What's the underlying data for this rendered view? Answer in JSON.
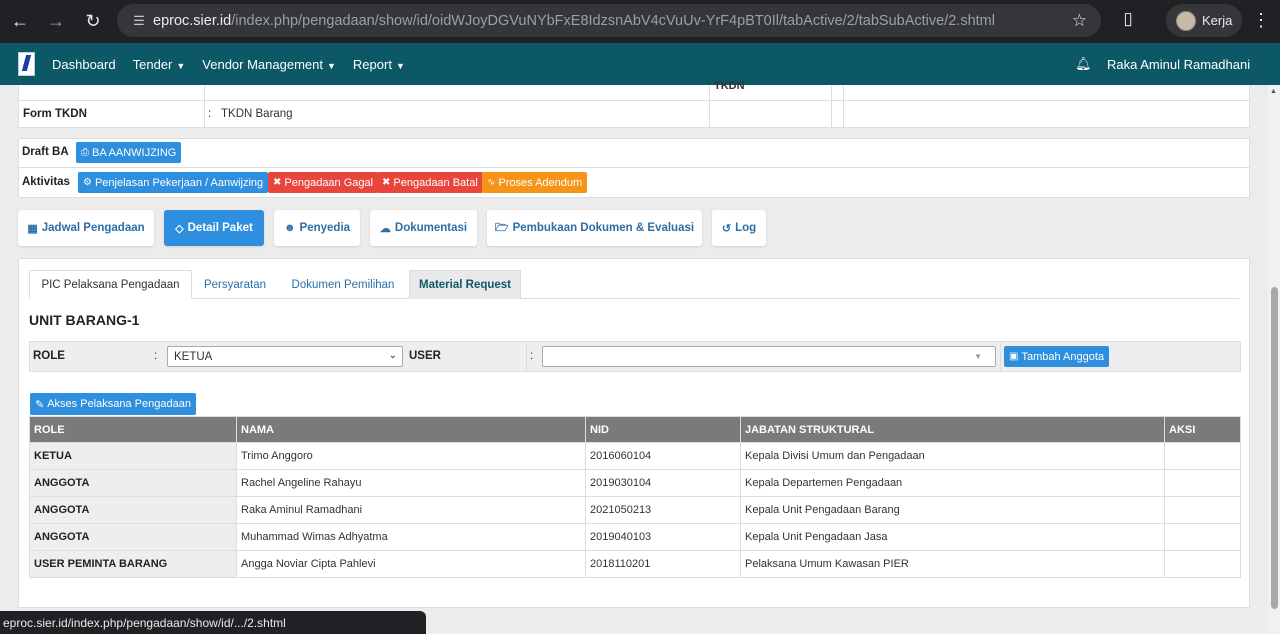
{
  "browser": {
    "url_host": "eproc.sier.id",
    "url_path": "/index.php/pengadaan/show/id/oidWJoyDGVuNYbFxE8IdzsnAbV4cVuUv-YrF4pBT0Il/tabActive/2/tabSubActive/2.shtml",
    "profile_name": "Kerja",
    "status_url": "eproc.sier.id/index.php/pengadaan/show/id/.../2.shtml"
  },
  "nav": {
    "dashboard": "Dashboard",
    "tender": "Tender",
    "vendor": "Vendor Management",
    "report": "Report",
    "user": "Raka Aminul Ramadhani"
  },
  "info": {
    "partial_text": "TKDN",
    "form_tkdn_label": "Form TKDN",
    "colon": ":",
    "form_tkdn_value": "TKDN Barang"
  },
  "actions": {
    "draft_label": "Draft BA",
    "draft_button": "BA AANWIJZING",
    "aktivitas_label": "Aktivitas",
    "buttons": [
      {
        "label": "Penjelasan Pekerjaan / Aanwijzing"
      },
      {
        "label": "Pengadaan Gagal"
      },
      {
        "label": "Pengadaan Batal"
      },
      {
        "label": "Proses Adendum"
      }
    ]
  },
  "tabs": [
    {
      "label": "Jadwal Pengadaan",
      "icon": "calendar-icon"
    },
    {
      "label": "Detail Paket",
      "icon": "diamond-icon"
    },
    {
      "label": "Penyedia",
      "icon": "users-icon"
    },
    {
      "label": "Dokumentasi",
      "icon": "cloud-upload-icon"
    },
    {
      "label": "Pembukaan Dokumen & Evaluasi",
      "icon": "folder-open-icon"
    },
    {
      "label": "Log",
      "icon": "history-icon"
    }
  ],
  "subtabs": [
    {
      "label": "PIC Pelaksana Pengadaan"
    },
    {
      "label": "Persyaratan"
    },
    {
      "label": "Dokumen Pemilihan"
    },
    {
      "label": "Material Request"
    }
  ],
  "unit_title": "UNIT BARANG-1",
  "form": {
    "role_label": "ROLE",
    "role_value": "KETUA",
    "user_label": "USER",
    "user_value": "",
    "colon": ":",
    "add_button": "Tambah Anggota"
  },
  "akses_button": "Akses Pelaksana Pengadaan",
  "table": {
    "headers": [
      "ROLE",
      "NAMA",
      "NID",
      "JABATAN STRUKTURAL",
      "AKSI"
    ],
    "rows": [
      {
        "role": "KETUA",
        "nama": "Trimo Anggoro",
        "nid": "2016060104",
        "jabatan": "Kepala Divisi Umum dan Pengadaan",
        "aksi": ""
      },
      {
        "role": "ANGGOTA",
        "nama": "Rachel Angeline Rahayu",
        "nid": "2019030104",
        "jabatan": "Kepala Departemen Pengadaan",
        "aksi": ""
      },
      {
        "role": "ANGGOTA",
        "nama": "Raka Aminul Ramadhani",
        "nid": "2021050213",
        "jabatan": "Kepala Unit Pengadaan Barang",
        "aksi": ""
      },
      {
        "role": "ANGGOTA",
        "nama": "Muhammad Wimas Adhyatma",
        "nid": "2019040103",
        "jabatan": "Kepala Unit Pengadaan Jasa",
        "aksi": ""
      },
      {
        "role": "USER PEMINTA BARANG",
        "nama": "Angga Noviar Cipta Pahlevi",
        "nid": "2018110201",
        "jabatan": "Pelaksana Umum Kawasan PIER",
        "aksi": ""
      }
    ]
  },
  "colors": {
    "navbar": "#0d5866",
    "primary": "#2d8fdd",
    "danger": "#e9453d",
    "warning": "#f59418"
  }
}
